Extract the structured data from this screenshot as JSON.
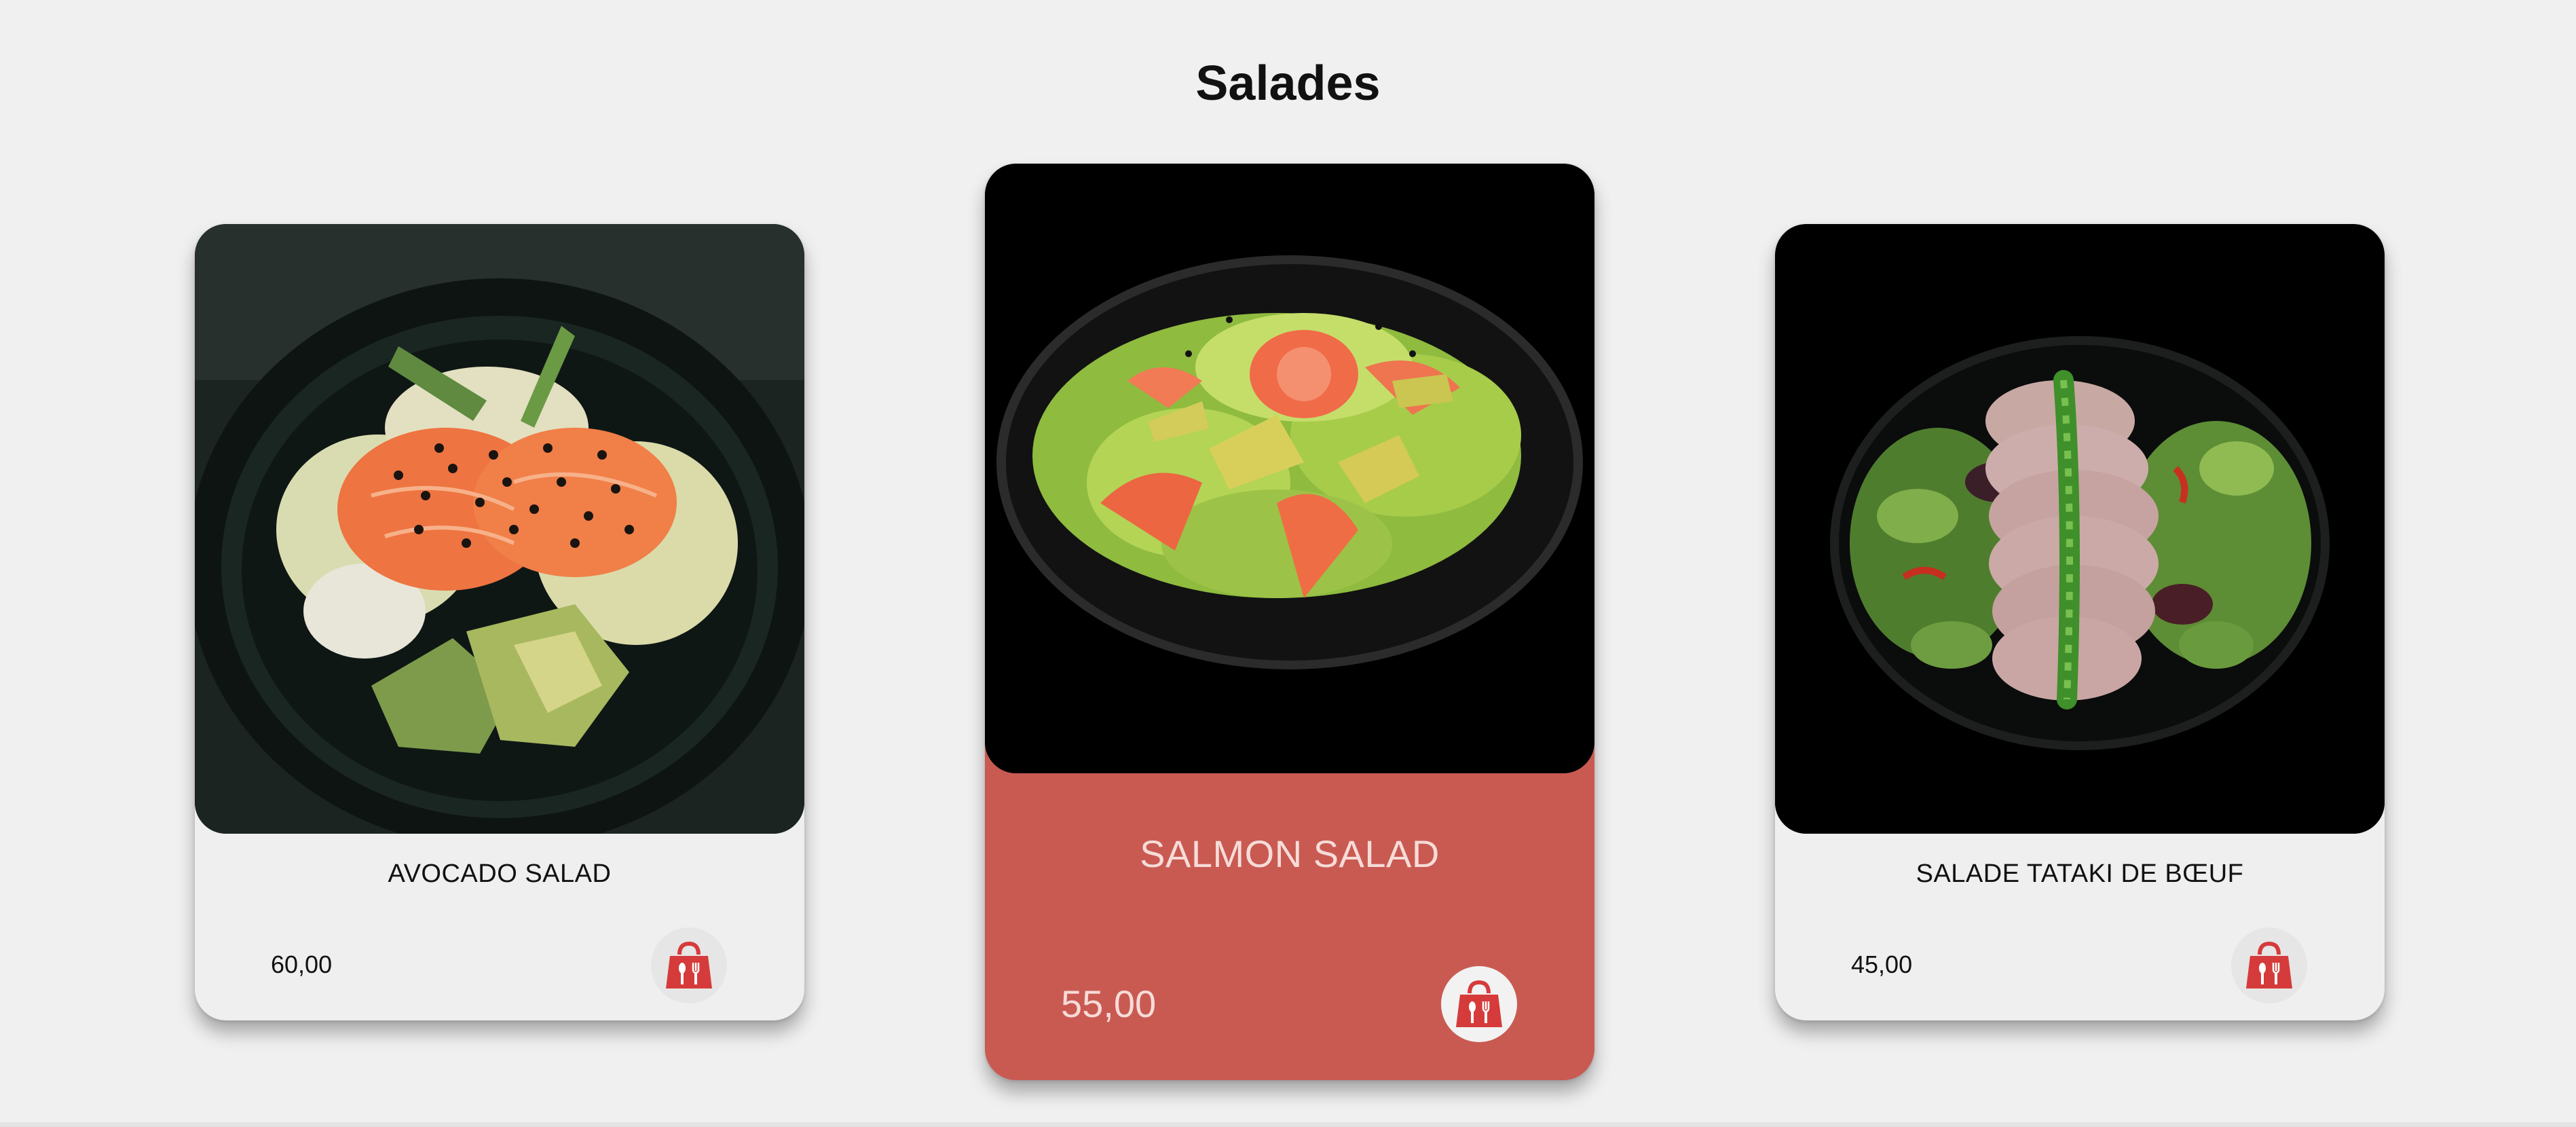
{
  "section": {
    "title": "Salades"
  },
  "products": [
    {
      "name": "AVOCADO SALAD",
      "price": "60,00"
    },
    {
      "name": "SALMON SALAD",
      "price": "55,00"
    },
    {
      "name": "SALADE TATAKI DE BŒUF",
      "price": "45,00"
    }
  ],
  "colors": {
    "page_background": "#f0f0f0",
    "highlight_card": "#c95a52",
    "cart_icon": "#d63b3b",
    "highlight_text": "#f6dcd8"
  },
  "icons": {
    "cart": "shopping-bag-utensils-icon"
  }
}
